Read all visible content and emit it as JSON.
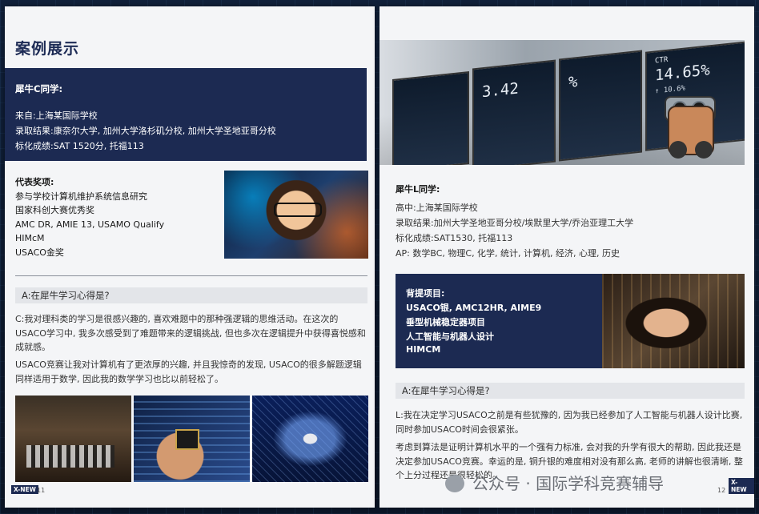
{
  "left_page": {
    "title": "案例展示",
    "student1": {
      "name": "犀牛C同学:",
      "from": "来自:上海某国际学校",
      "admission": "录取结果:康奈尔大学, 加州大学洛杉矶分校, 加州大学圣地亚哥分校",
      "scores": "标化成绩:SAT 1520分, 托福113"
    },
    "awards": {
      "heading": "代表奖项:",
      "items": [
        "参与学校计算机维护系统信息研究",
        "国家科创大赛优秀奖",
        "AMC DR, AMIE 13, USAMO Qualify",
        "HIMcM",
        "USACO金奖"
      ]
    },
    "qa_question": "A:在犀牛学习心得是?",
    "answer_p1": "C:我对理科类的学习是很感兴趣的, 喜欢难题中的那种强逻辑的思维活动。在这次的USACO学习中, 我多次感受到了难题带来的逻辑挑战, 但也多次在逻辑提升中获得喜悦感和成就感。",
    "answer_p2": "USACO竞赛让我对计算机有了更浓厚的兴趣, 并且我惊奇的发现, USACO的很多解题逻辑同样适用于数学, 因此我的数学学习也比以前轻松了。",
    "footer_tag": "X-NEW",
    "page_number": "11"
  },
  "right_page": {
    "screens": {
      "ctr_label": "CTR",
      "ctr_value": "14.65%",
      "ctr_sub": "↑ 10.6%",
      "screen2_value": "3.42",
      "screen3_value": "%"
    },
    "student2": {
      "name": "犀牛L同学:",
      "school": "高中:上海某国际学校",
      "admission": "录取结果:加州大学圣地亚哥分校/埃默里大学/乔治亚理工大学",
      "scores": "标化成绩:SAT1530, 托福113",
      "ap": "AP: 数学BC, 物理C, 化学, 统计, 计算机, 经济, 心理, 历史"
    },
    "background": {
      "heading": "背提项目:",
      "items": [
        "USACO银, AMC12HR, AIME9",
        "垂型机械稳定器项目",
        "人工智能与机器人设计",
        "HIMCM"
      ]
    },
    "qa_question": "A:在犀牛学习心得是?",
    "answer_p1": "L:我在决定学习USACO之前是有些犹豫的, 因为我已经参加了人工智能与机器人设计比赛, 同时参加USACO时间会很紧张。",
    "answer_p2": "考虑到算法是证明计算机水平的一个强有力标准, 会对我的升学有很大的帮助, 因此我还是决定参加USACO竞赛。幸运的是, 铜升银的难度相对没有那么高, 老师的讲解也很清晰, 整个上分过程还是很轻松的。",
    "footer_tag": "X-NEW",
    "page_number": "12"
  },
  "watermark": "公众号 · 国际学科竞赛辅导"
}
